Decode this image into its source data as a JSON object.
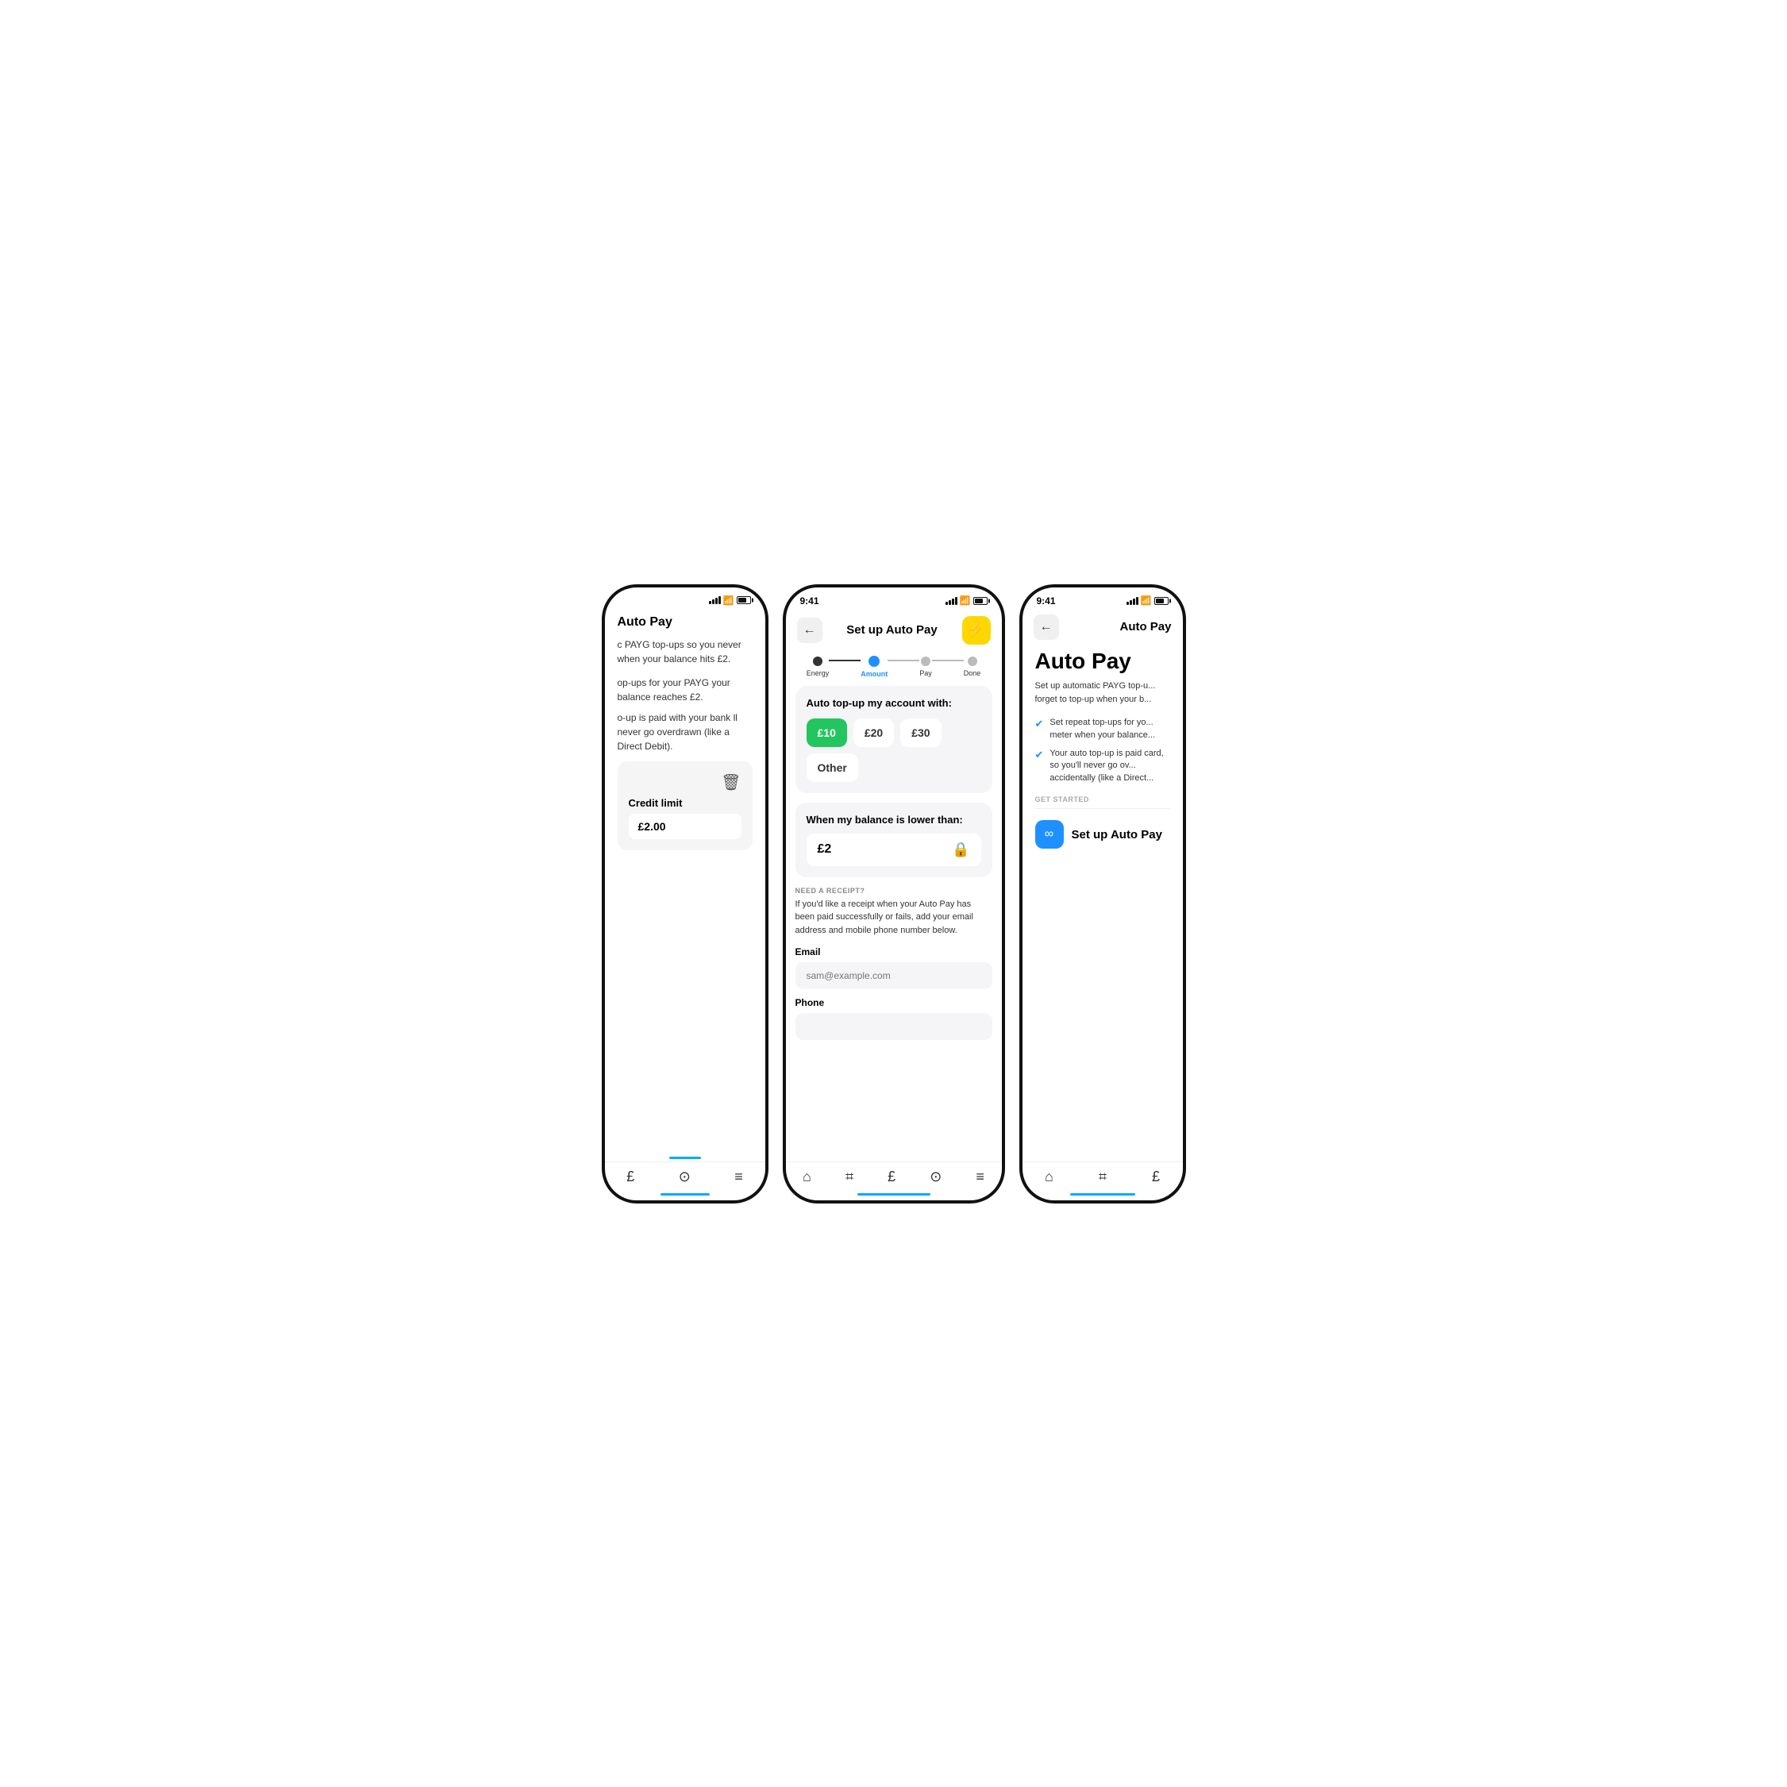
{
  "scene": {
    "background": "#ffffff"
  },
  "left_phone": {
    "status_bar": {
      "time": "",
      "signal": true,
      "wifi": true,
      "battery": true
    },
    "header": "Auto Pay",
    "description1": "c PAYG top-ups so you never when your balance hits £2.",
    "description2": "op-ups for your PAYG your balance reaches £2.",
    "description3": "o-up is paid with your bank ll never go overdrawn (like a Direct Debit).",
    "credit_limit": {
      "label": "Credit limit",
      "value": "£2.00"
    },
    "nav_items": [
      "£",
      "?",
      "≡"
    ]
  },
  "center_phone": {
    "status_bar": {
      "time": "9:41",
      "signal": true,
      "wifi": true,
      "battery": true
    },
    "header": {
      "back_label": "←",
      "title": "Set up Auto Pay",
      "action_icon": "⚡"
    },
    "stepper": {
      "steps": [
        {
          "label": "Energy",
          "state": "done"
        },
        {
          "label": "Amount",
          "state": "active"
        },
        {
          "label": "Pay",
          "state": "inactive"
        },
        {
          "label": "Done",
          "state": "inactive"
        }
      ]
    },
    "amount_card": {
      "title": "Auto top-up my account with:",
      "options": [
        {
          "label": "£10",
          "selected": true
        },
        {
          "label": "£20",
          "selected": false
        },
        {
          "label": "£30",
          "selected": false
        },
        {
          "label": "Other",
          "selected": false
        }
      ]
    },
    "balance_card": {
      "title": "When my balance is lower than:",
      "value": "£2"
    },
    "receipt_section": {
      "label": "NEED A RECEIPT?",
      "description": "If you'd like a receipt when your Auto Pay has been paid successfully or fails, add your email address and mobile phone number below.",
      "email_label": "Email",
      "email_placeholder": "sam@example.com",
      "phone_label": "Phone"
    },
    "nav_items": [
      "🏠",
      "⌗",
      "£",
      "?",
      "≡"
    ]
  },
  "right_phone": {
    "status_bar": {
      "time": "9:41",
      "signal": true,
      "wifi": true,
      "battery": true
    },
    "header": {
      "back_label": "←",
      "title": "Auto Pay"
    },
    "hero_title": "Auto Pay",
    "description": "Set up automatic PAYG top-u... forget to top-up when your b...",
    "check_items": [
      "Set repeat top-ups for yo... meter when your balance...",
      "Your auto top-up is paid card, so you'll never go ov... accidentally (like a Direct..."
    ],
    "get_started_label": "GET STARTED",
    "setup_button": {
      "icon": "∞",
      "label": "Set up Auto Pay"
    },
    "nav_items": [
      "🏠",
      "⌗",
      "£"
    ]
  }
}
